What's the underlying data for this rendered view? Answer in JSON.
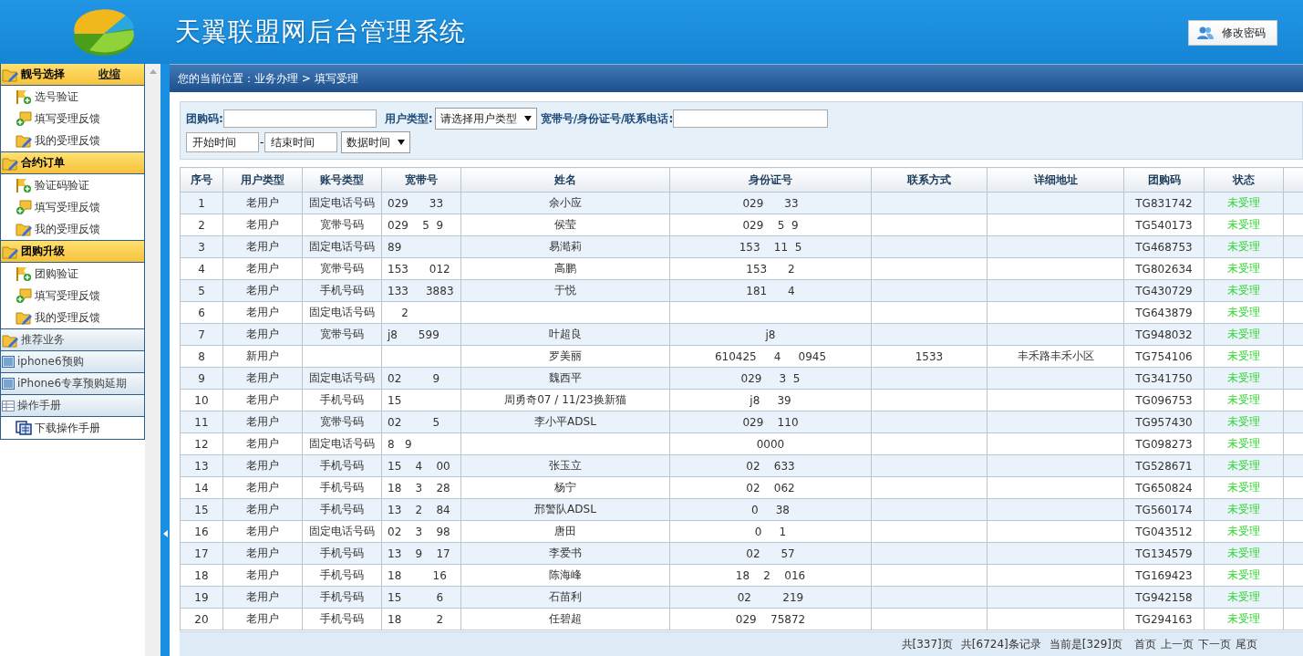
{
  "header": {
    "title": "天翼联盟网后台管理系统",
    "button": "修改密码"
  },
  "sidebar": {
    "collapse_link": "收缩",
    "groups": [
      {
        "label": "靓号选择",
        "highlighted": true,
        "kind": "folder",
        "items": [
          {
            "label": "选号验证",
            "kind": "flag"
          },
          {
            "label": "填写受理反馈",
            "kind": "note"
          },
          {
            "label": "我的受理反馈",
            "kind": "folder"
          }
        ]
      },
      {
        "label": "合约订单",
        "highlighted": true,
        "kind": "folder",
        "items": [
          {
            "label": "验证码验证",
            "kind": "flag"
          },
          {
            "label": "填写受理反馈",
            "kind": "note"
          },
          {
            "label": "我的受理反馈",
            "kind": "folder"
          }
        ]
      },
      {
        "label": "团购升级",
        "highlighted": true,
        "kind": "folder",
        "items": [
          {
            "label": "团购验证",
            "kind": "flag"
          },
          {
            "label": "填写受理反馈",
            "kind": "note"
          },
          {
            "label": "我的受理反馈",
            "kind": "folder"
          }
        ]
      },
      {
        "label": "推荐业务",
        "highlighted": false,
        "kind": "folder"
      },
      {
        "label": "iphone6预购",
        "highlighted": false,
        "kind": "window"
      },
      {
        "label": "iPhone6专享预购延期",
        "highlighted": false,
        "kind": "window"
      },
      {
        "label": "操作手册",
        "highlighted": false,
        "kind": "table",
        "items": [
          {
            "label": "下载操作手册",
            "kind": "doc"
          }
        ]
      }
    ]
  },
  "breadcrumb": "您的当前位置：业务办理 > 填写受理",
  "filters": {
    "group_code_label": "团购码:",
    "user_type_label": "用户类型:",
    "user_type_value": "请选择用户类型",
    "search_label": "宽带号/身份证号/联系电话:",
    "start_placeholder": "开始时间",
    "separator": "-",
    "end_placeholder": "结束时间",
    "time_type_value": "数据时间"
  },
  "table": {
    "columns": [
      "序号",
      "用户类型",
      "账号类型",
      "宽带号",
      "姓名",
      "身份证号",
      "联系方式",
      "详细地址",
      "团购码",
      "状态"
    ],
    "rows": [
      [
        "1",
        "老用户",
        "固定电话号码",
        "029      33",
        "余小应",
        "029      33",
        "",
        "",
        "TG831742",
        "未受理"
      ],
      [
        "2",
        "老用户",
        "宽带号码",
        "029    5  9",
        "侯莹",
        "029    5  9",
        "",
        "",
        "TG540173",
        "未受理"
      ],
      [
        "3",
        "老用户",
        "固定电话号码",
        "89",
        "易澔莉",
        "153    11  5",
        "",
        "",
        "TG468753",
        "未受理"
      ],
      [
        "4",
        "老用户",
        "宽带号码",
        "153      012",
        "高鹏",
        "153      2",
        "",
        "",
        "TG802634",
        "未受理"
      ],
      [
        "5",
        "老用户",
        "手机号码",
        "133     3883",
        "于悦",
        "181      4",
        "",
        "",
        "TG430729",
        "未受理"
      ],
      [
        "6",
        "老用户",
        "固定电话号码",
        "    2",
        "",
        "",
        "",
        "",
        "TG643879",
        "未受理"
      ],
      [
        "7",
        "老用户",
        "宽带号码",
        "j8      599",
        "叶超良",
        "j8",
        "",
        "",
        "TG948032",
        "未受理"
      ],
      [
        "8",
        "新用户",
        "",
        "",
        "罗美丽",
        "610425     4     0945",
        "1533",
        "丰禾路丰禾小区",
        "TG754106",
        "未受理"
      ],
      [
        "9",
        "老用户",
        "固定电话号码",
        "02         9",
        "魏西平",
        "029     3  5",
        "",
        "",
        "TG341750",
        "未受理"
      ],
      [
        "10",
        "老用户",
        "手机号码",
        "15",
        "周勇奇07 / 11/23换新猫",
        "j8     39",
        "",
        "",
        "TG096753",
        "未受理"
      ],
      [
        "11",
        "老用户",
        "宽带号码",
        "02         5",
        "李小平ADSL",
        "029    110",
        "",
        "",
        "TG957430",
        "未受理"
      ],
      [
        "12",
        "老用户",
        "固定电话号码",
        "8   9",
        "",
        "0000",
        "",
        "",
        "TG098273",
        "未受理"
      ],
      [
        "13",
        "老用户",
        "手机号码",
        "15    4    00",
        "张玉立",
        "02    633",
        "",
        "",
        "TG528671",
        "未受理"
      ],
      [
        "14",
        "老用户",
        "手机号码",
        "18    3    28",
        "杨宁",
        "02    062",
        "",
        "",
        "TG650824",
        "未受理"
      ],
      [
        "15",
        "老用户",
        "手机号码",
        "13    2    84",
        "邢警队ADSL",
        "0     38",
        "",
        "",
        "TG560174",
        "未受理"
      ],
      [
        "16",
        "老用户",
        "固定电话号码",
        "02    3    98",
        "唐田",
        "0     1",
        "",
        "",
        "TG043512",
        "未受理"
      ],
      [
        "17",
        "老用户",
        "手机号码",
        "13    9    17",
        "李爱书",
        "02      57",
        "",
        "",
        "TG134579",
        "未受理"
      ],
      [
        "18",
        "老用户",
        "手机号码",
        "18         16",
        "陈海峰",
        "18    2    016",
        "",
        "",
        "TG169423",
        "未受理"
      ],
      [
        "19",
        "老用户",
        "手机号码",
        "15          6",
        "石苗利",
        "02         219",
        "",
        "",
        "TG942158",
        "未受理"
      ],
      [
        "20",
        "老用户",
        "手机号码",
        "18          2",
        "任碧超",
        "029    75872",
        "",
        "",
        "TG294163",
        "未受理"
      ]
    ]
  },
  "pager": [
    "共[337]页",
    "共[6724]条记录",
    "当前是[329]页",
    "首页",
    "上一页",
    "下一页",
    "尾页"
  ]
}
